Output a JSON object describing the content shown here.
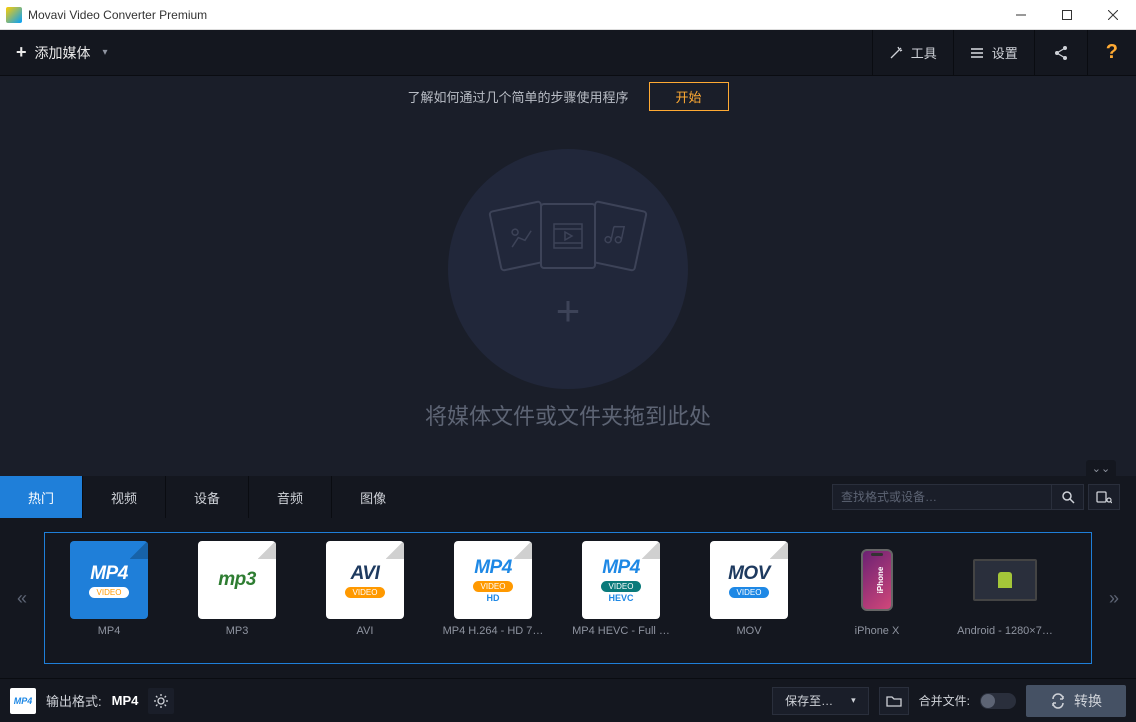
{
  "window": {
    "title": "Movavi Video Converter Premium"
  },
  "toolbar": {
    "add_media": "添加媒体",
    "tools": "工具",
    "settings": "设置"
  },
  "banner": {
    "text": "了解如何通过几个简单的步骤使用程序",
    "button": "开始"
  },
  "drop": {
    "text": "将媒体文件或文件夹拖到此处"
  },
  "tabs": {
    "items": [
      "热门",
      "视频",
      "设备",
      "音频",
      "图像"
    ],
    "active_index": 0
  },
  "search": {
    "placeholder": "查找格式或设备…"
  },
  "presets": [
    {
      "label": "MP4",
      "kind": "mp4",
      "line1": "MP4",
      "band": "VIDEO",
      "active": true
    },
    {
      "label": "MP3",
      "kind": "mp3",
      "line1": "mp3"
    },
    {
      "label": "AVI",
      "kind": "avi",
      "line1": "AVI",
      "band": "VIDEO"
    },
    {
      "label": "MP4 H.264 - HD 7…",
      "kind": "mp4",
      "line1": "MP4",
      "band": "VIDEO",
      "sub": "HD"
    },
    {
      "label": "MP4 HEVC - Full …",
      "kind": "mp4",
      "line1": "MP4",
      "band": "VIDEO",
      "sub": "HEVC"
    },
    {
      "label": "MOV",
      "kind": "mov",
      "line1": "MOV",
      "band": "VIDEO"
    },
    {
      "label": "iPhone X",
      "kind": "iphone"
    },
    {
      "label": "Android - 1280×7…",
      "kind": "android"
    }
  ],
  "footer": {
    "output_label": "输出格式:",
    "output_format": "MP4",
    "save_to": "保存至…",
    "merge_label": "合并文件:",
    "convert": "转换"
  }
}
